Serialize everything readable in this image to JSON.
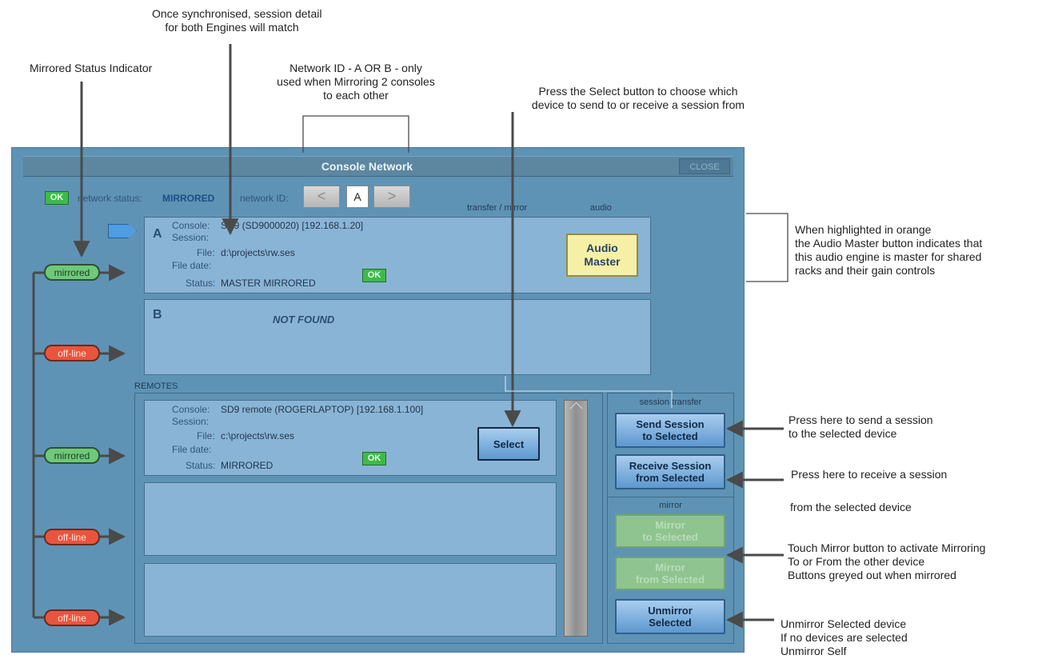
{
  "annotations": {
    "sync_note": "Once synchronised, session detail\nfor both Engines will match",
    "mirrored_status": "Mirrored Status Indicator",
    "network_id_note": "Network ID - A OR B - only\nused when Mirroring 2 consoles\nto each other",
    "select_note": "Press the Select button to choose which\ndevice to send to or receive a session from",
    "audio_master_note": "When highlighted in orange\nthe Audio Master button indicates that\nthis audio engine is master for shared\nracks and their gain controls",
    "send_note": "Press here to send a session\nto the selected device",
    "receive_note": "Press here to receive a session",
    "receive_note_2": "from the selected device",
    "mirror_note": "Touch Mirror button to activate Mirroring\nTo or From the other device\nButtons greyed out when mirrored",
    "unmirror_note": "Unmirror Selected device\nIf no devices are selected\nUnmirror Self"
  },
  "window": {
    "title": "Console Network",
    "close_label": "CLOSE",
    "status_ok": "OK",
    "network_status_label": "network status:",
    "network_status_value": "MIRRORED",
    "network_id_label": "network ID:",
    "network_id_value": "A",
    "nav_prev": "<",
    "nav_next": ">",
    "col_transfer": "transfer / mirror",
    "col_audio": "audio",
    "remotes_label": "REMOTES"
  },
  "engine_a": {
    "letter": "A",
    "console_label": "Console:",
    "console_value": "SD9 (SD9000020)  [192.168.1.20]",
    "session_label": "Session:",
    "file_label": "File:",
    "file_value": "d:\\projects\\rw.ses",
    "filedate_label": "File date:",
    "status_label": "Status:",
    "status_value": "MASTER MIRRORED",
    "ok": "OK",
    "audio_master": "Audio\nMaster"
  },
  "engine_b": {
    "letter": "B",
    "not_found": "NOT FOUND"
  },
  "remote_1": {
    "console_label": "Console:",
    "console_value": "SD9 remote (ROGERLAPTOP)  [192.168.1.100]",
    "session_label": "Session:",
    "file_label": "File:",
    "file_value": "c:\\projects\\rw.ses",
    "filedate_label": "File date:",
    "status_label": "Status:",
    "status_value": "MIRRORED",
    "ok": "OK",
    "select": "Select"
  },
  "side_panel": {
    "session_transfer_label": "session transfer",
    "send_session": "Send Session\nto Selected",
    "receive_session": "Receive Session\nfrom Selected",
    "mirror_label": "mirror",
    "mirror_to": "Mirror\nto Selected",
    "mirror_from": "Mirror\nfrom Selected",
    "unmirror": "Unmirror\nSelected"
  },
  "indicators": [
    "mirrored",
    "off-line",
    "mirrored",
    "off-line",
    "off-line"
  ],
  "colors": {
    "mirrored": "#6fc97a",
    "offline": "#e8553e",
    "window_bg": "#5f93b5",
    "panel_bg": "#8ab4d5",
    "audio_master": "#f6f0a6",
    "button_blue": "#5e98cf"
  }
}
